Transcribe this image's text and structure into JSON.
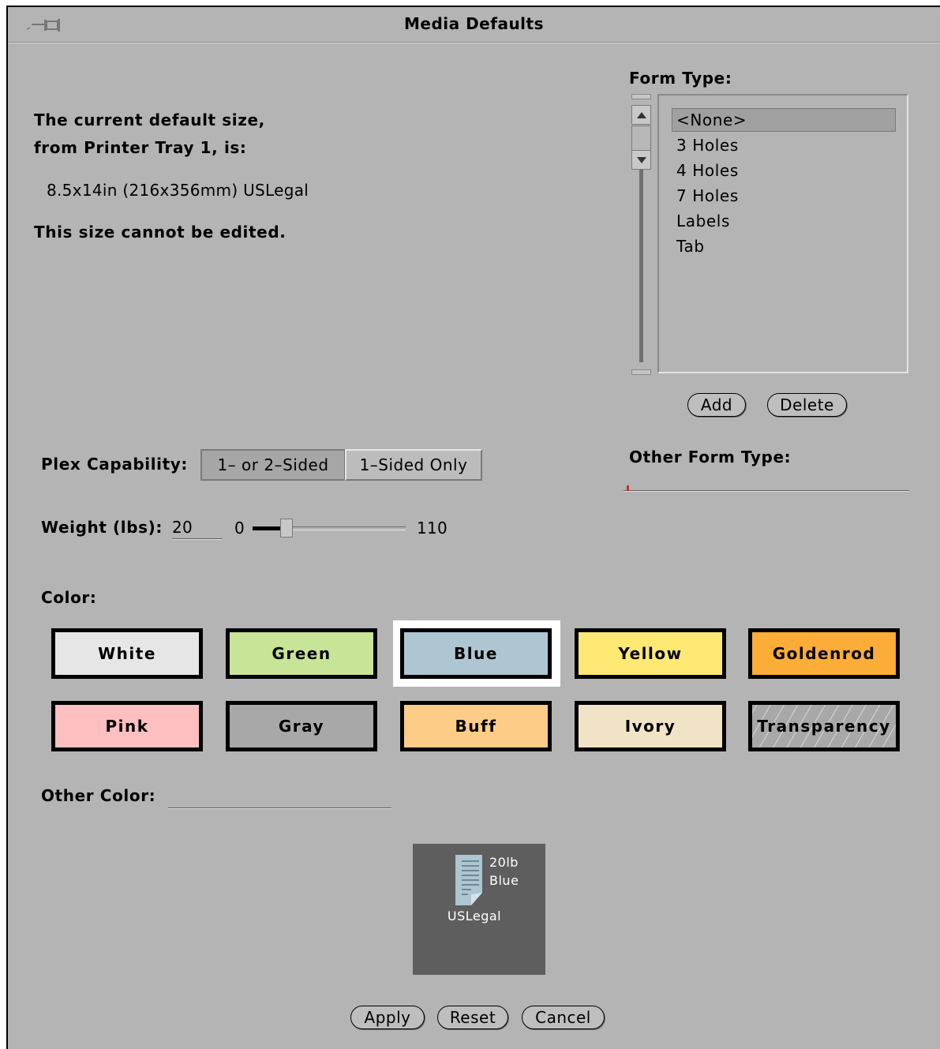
{
  "window": {
    "title": "Media Defaults"
  },
  "info": {
    "line1": "The current default size,",
    "line2": "from Printer Tray 1, is:",
    "size": "8.5x14in (216x356mm) USLegal",
    "note": "This size cannot be edited."
  },
  "form_type": {
    "label": "Form Type:",
    "items": [
      "<None>",
      "3 Holes",
      "4 Holes",
      "7 Holes",
      "Labels",
      "Tab"
    ],
    "selected": "<None>",
    "add_label": "Add",
    "delete_label": "Delete",
    "other_label": "Other Form Type:",
    "other_value": ""
  },
  "plex": {
    "label": "Plex Capability:",
    "options": [
      "1– or 2–Sided",
      "1–Sided Only"
    ],
    "selected": "1– or 2–Sided"
  },
  "weight": {
    "label": "Weight (lbs):",
    "value": "20",
    "min": "0",
    "max": "110",
    "slider_fraction": 0.18
  },
  "color": {
    "label": "Color:",
    "swatches": [
      {
        "name": "White",
        "hex": "#e6e6e6"
      },
      {
        "name": "Green",
        "hex": "#c8e496"
      },
      {
        "name": "Blue",
        "hex": "#aec6d2"
      },
      {
        "name": "Yellow",
        "hex": "#fde874"
      },
      {
        "name": "Goldenrod",
        "hex": "#fbad38"
      },
      {
        "name": "Pink",
        "hex": "#fdbfc0"
      },
      {
        "name": "Gray",
        "hex": "#a8a8a8"
      },
      {
        "name": "Buff",
        "hex": "#fdcd88"
      },
      {
        "name": "Ivory",
        "hex": "#f1e4c6"
      },
      {
        "name": "Transparency",
        "hex": "#a8a8a8"
      }
    ],
    "selected": "Blue",
    "other_label": "Other Color:",
    "other_value": ""
  },
  "preview": {
    "weight": "20lb",
    "color": "Blue",
    "size": "USLegal"
  },
  "buttons": {
    "apply": "Apply",
    "reset": "Reset",
    "cancel": "Cancel"
  }
}
